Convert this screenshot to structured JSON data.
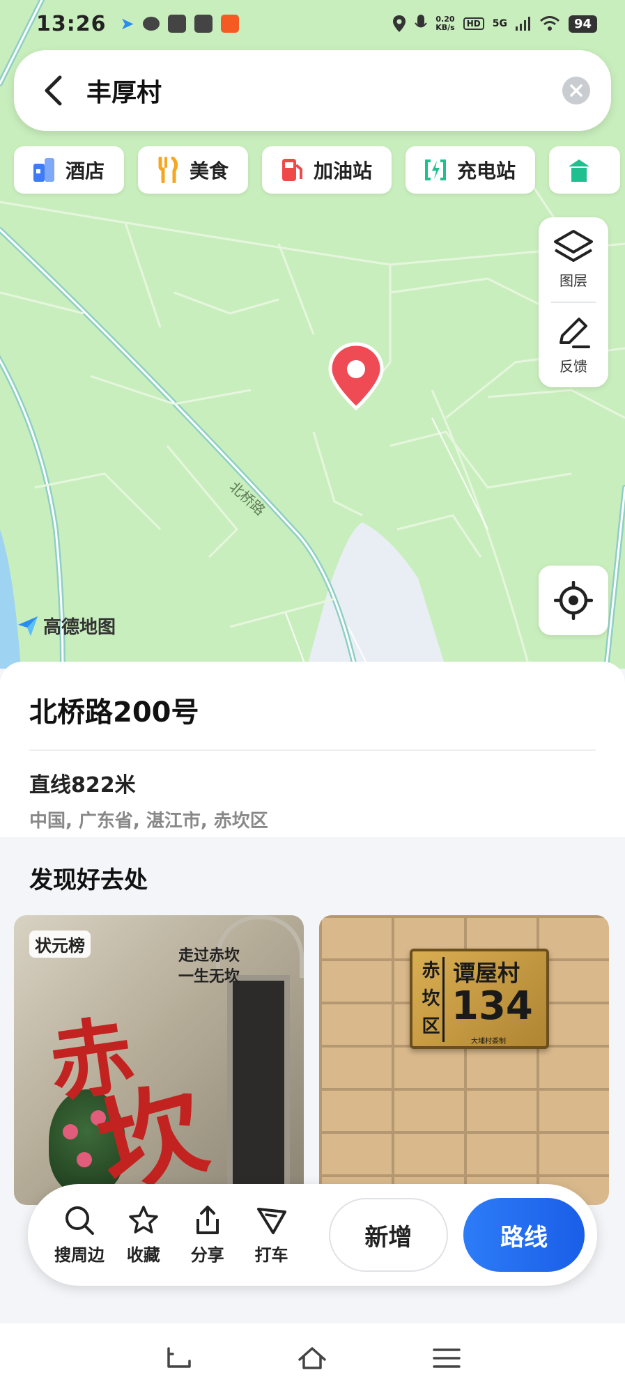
{
  "status_bar": {
    "time": "13:26",
    "network_speed_value": "0.20",
    "network_speed_unit": "KB/s",
    "hd_badge": "HD",
    "signal": "5G",
    "battery": "94"
  },
  "search": {
    "query": "丰厚村"
  },
  "categories": [
    {
      "label": "酒店",
      "icon": "hotel-icon",
      "color": "#3d7cf3"
    },
    {
      "label": "美食",
      "icon": "food-icon",
      "color": "#f5a623"
    },
    {
      "label": "加油站",
      "icon": "gas-station-icon",
      "color": "#ef4a4a"
    },
    {
      "label": "充电站",
      "icon": "charging-station-icon",
      "color": "#1fbf8f"
    }
  ],
  "map_controls": {
    "layers_label": "图层",
    "feedback_label": "反馈"
  },
  "map": {
    "road_label": "北桥路",
    "logo_text": "高德地图"
  },
  "place": {
    "title": "北桥路200号",
    "distance": "直线822米",
    "address": "中国, 广东省, 湛江市, 赤坎区"
  },
  "discover": {
    "heading": "发现好去处",
    "cards": [
      {
        "tag": "状元榜",
        "slogan_line1": "走过赤坎",
        "slogan_line2": "一生无坎",
        "big_char1": "赤",
        "big_char2": "坎"
      },
      {
        "plate_left": "赤坎区",
        "plate_name": "谭屋村",
        "plate_number": "134",
        "plate_small": "大埔村委制"
      }
    ]
  },
  "actions": {
    "search_nearby": "搜周边",
    "favorite": "收藏",
    "share": "分享",
    "taxi": "打车",
    "add_new": "新增",
    "route": "路线"
  }
}
